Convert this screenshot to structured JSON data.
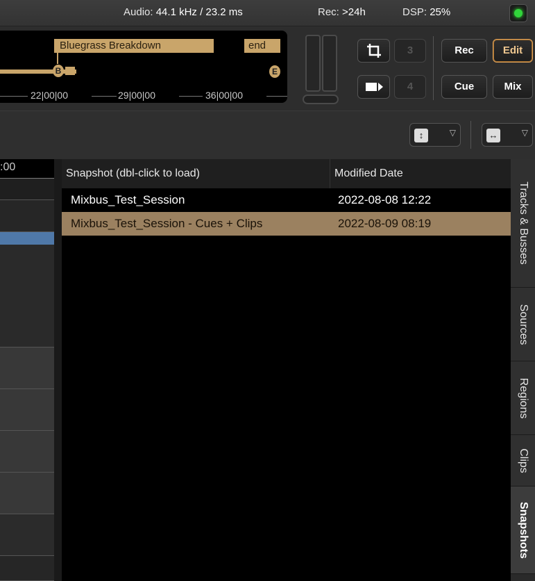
{
  "status": {
    "audio_label": "Audio:",
    "audio_value": "44.1 kHz / 23.2 ms",
    "rec_label": "Rec:",
    "rec_value": ">24h",
    "dsp_label": "DSP:",
    "dsp_value": "25%",
    "led_color": "#31d53b"
  },
  "mini_timeline": {
    "marker_name": "Bluegrass Breakdown",
    "end_label": "end",
    "start_marker": "B",
    "end_marker": "E",
    "ticks": [
      "22|00|00",
      "29|00|00",
      "36|00|00"
    ],
    "accent": "#c9a56a"
  },
  "transport_buttons": {
    "crop_icon": "crop-icon",
    "slot3": "3",
    "slot4": "4",
    "rec": "Rec",
    "edit": "Edit",
    "cue": "Cue",
    "mix": "Mix"
  },
  "editor": {
    "ruler_time": ":00"
  },
  "snapshots": {
    "col_name": "Snapshot (dbl-click to load)",
    "col_date": "Modified Date",
    "rows": [
      {
        "name": "Mixbus_Test_Session",
        "date": "2022-08-08 12:22",
        "selected": false
      },
      {
        "name": "Mixbus_Test_Session - Cues + Clips",
        "date": "2022-08-09 08:19",
        "selected": true
      }
    ],
    "selection_color": "#9b8160"
  },
  "sidebar_tabs": [
    "Tracks & Busses",
    "Sources",
    "Regions",
    "Clips",
    "Snapshots"
  ],
  "active_tab": "Snapshots"
}
